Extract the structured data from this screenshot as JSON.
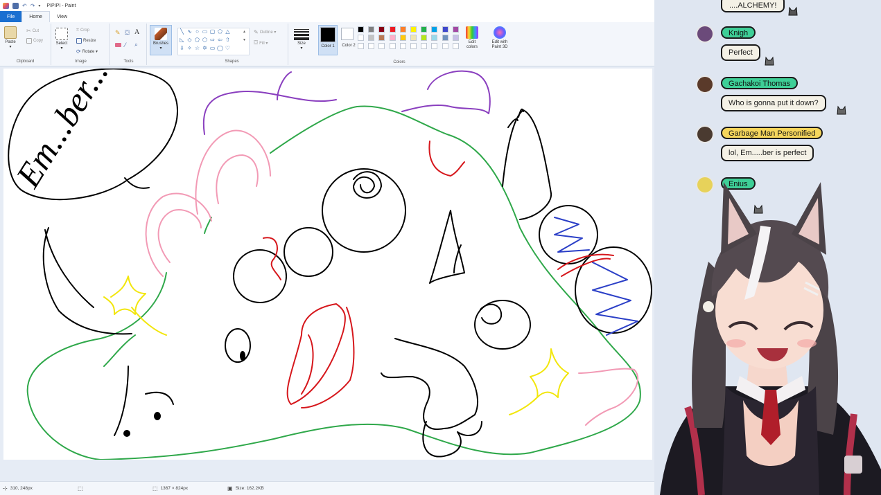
{
  "window": {
    "title": "PIPIPI - Paint"
  },
  "tabs": [
    "File",
    "Home",
    "View"
  ],
  "ribbon": {
    "clipboard": {
      "paste": "Paste",
      "cut": "Cut",
      "copy": "Copy",
      "label": "Clipboard"
    },
    "image": {
      "select": "Select",
      "crop": "Crop",
      "resize": "Resize",
      "rotate": "Rotate ▾",
      "label": "Image"
    },
    "tools": {
      "label": "Tools"
    },
    "brushes": {
      "label": "Brushes"
    },
    "shapes": {
      "outline": "Outline ▾",
      "fill": "Fill ▾",
      "label": "Shapes"
    },
    "size": {
      "label": "Size"
    },
    "color1": {
      "label": "Color 1"
    },
    "color2": {
      "label": "Color 2"
    },
    "colors": {
      "label": "Colors"
    },
    "edit_colors": "Edit colors",
    "edit_paint3d": "Edit with Paint 3D"
  },
  "palette_row1": [
    "#000000",
    "#7f7f7f",
    "#880015",
    "#ed1c24",
    "#ff7f27",
    "#fff200",
    "#22b14c",
    "#00a2e8",
    "#3f48cc",
    "#a349a4"
  ],
  "palette_row2": [
    "#ffffff",
    "#c3c3c3",
    "#b97a57",
    "#ffaec9",
    "#ffc90e",
    "#efe4b0",
    "#b5e61d",
    "#99d9ea",
    "#7092be",
    "#c8bfe7"
  ],
  "palette_row3": [
    "#ffffff",
    "#ffffff",
    "#ffffff",
    "#ffffff",
    "#ffffff",
    "#ffffff",
    "#ffffff",
    "#ffffff",
    "#ffffff",
    "#ffffff"
  ],
  "canvas": {
    "speech_text": "Em...ber...?"
  },
  "status": {
    "cursor": "310, 248px",
    "dimensions": "1367 × 824px",
    "size": "Size: 162.2KB"
  },
  "chat": {
    "top_bubble": "....ALCHEMY!",
    "messages": [
      {
        "name": "Knigh",
        "text": "Perfect",
        "pill_color": "#3ecf97",
        "avatar_color": "#6b4a7a"
      },
      {
        "name": "Gachakoi Thomas",
        "text": "Who is gonna put it down?",
        "pill_color": "#3ecf97",
        "avatar_color": "#5a3a2a"
      },
      {
        "name": "Garbage Man Personified",
        "text": "lol, Em.....ber is perfect",
        "pill_color": "#f5d65c",
        "avatar_color": "#4a3a30"
      },
      {
        "name": "Enius",
        "text": "",
        "pill_color": "#3ecf97",
        "avatar_color": "#e7d25a"
      }
    ]
  }
}
